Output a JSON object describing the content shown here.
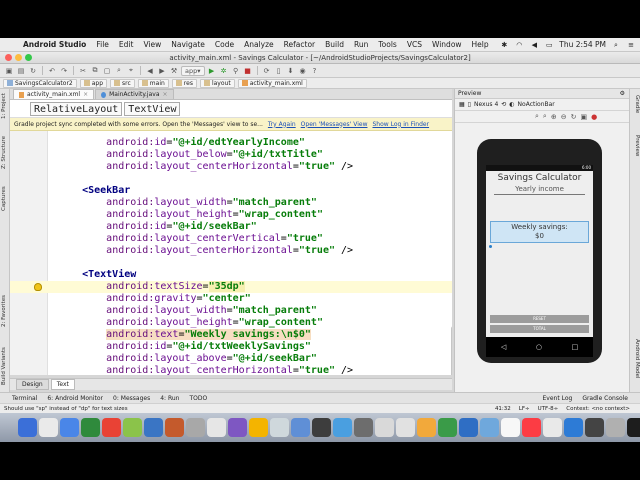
{
  "menubar": {
    "app_name": "Android Studio",
    "items": [
      "File",
      "Edit",
      "View",
      "Navigate",
      "Code",
      "Analyze",
      "Refactor",
      "Build",
      "Run",
      "Tools",
      "VCS",
      "Window",
      "Help"
    ],
    "clock": "Thu 2:54 PM"
  },
  "window": {
    "title": "activity_main.xml - Savings Calculator - [~/AndroidStudioProjects/SavingsCalculator2]"
  },
  "toolbar": {
    "run_config": "app"
  },
  "breadcrumbs": [
    "SavingsCalculator2",
    "app",
    "src",
    "main",
    "res",
    "layout",
    "activity_main.xml"
  ],
  "left_strip": [
    "1: Project",
    "Z: Structure",
    "Captures",
    "2: Favorites",
    "Build Variants"
  ],
  "right_strip": [
    "Gradle",
    "Preview",
    "Android Model"
  ],
  "editor_tabs": [
    {
      "label": "activity_main.xml",
      "active": true
    },
    {
      "label": "MainActivity.java",
      "active": false
    }
  ],
  "tag_path": [
    "RelativeLayout",
    "TextView"
  ],
  "banner": {
    "message": "Gradle project sync completed with some errors. Open the 'Messages' view to se...",
    "links": [
      "Try Again",
      "Open 'Messages' View",
      "Show Log in Finder"
    ]
  },
  "code_lines": [
    {
      "indent": "        ",
      "ns": "android",
      "attr": "id",
      "val": "\"@+id/edtYearlyIncome\"",
      "tail": ""
    },
    {
      "indent": "        ",
      "ns": "android",
      "attr": "layout_below",
      "val": "\"@+id/txtTitle\"",
      "tail": ""
    },
    {
      "indent": "        ",
      "ns": "android",
      "attr": "layout_centerHorizontal",
      "val": "\"true\"",
      "tail": " />"
    },
    {
      "blank": true
    },
    {
      "tagline": "    <SeekBar"
    },
    {
      "indent": "        ",
      "ns": "android",
      "attr": "layout_width",
      "val": "\"match_parent\"",
      "tail": ""
    },
    {
      "indent": "        ",
      "ns": "android",
      "attr": "layout_height",
      "val": "\"wrap_content\"",
      "tail": ""
    },
    {
      "indent": "        ",
      "ns": "android",
      "attr": "id",
      "val": "\"@+id/seekBar\"",
      "tail": ""
    },
    {
      "indent": "        ",
      "ns": "android",
      "attr": "layout_centerVertical",
      "val": "\"true\"",
      "tail": ""
    },
    {
      "indent": "        ",
      "ns": "android",
      "attr": "layout_centerHorizontal",
      "val": "\"true\"",
      "tail": " />"
    },
    {
      "blank": true
    },
    {
      "tagline": "    <TextView"
    },
    {
      "indent": "        ",
      "ns": "android",
      "attr": "textSize",
      "val": "\"35dp\"",
      "tail": "",
      "highlight": true,
      "valbox": "warn"
    },
    {
      "indent": "        ",
      "ns": "android",
      "attr": "gravity",
      "val": "\"center\"",
      "tail": ""
    },
    {
      "indent": "        ",
      "ns": "android",
      "attr": "layout_width",
      "val": "\"match_parent\"",
      "tail": ""
    },
    {
      "indent": "        ",
      "ns": "android",
      "attr": "layout_height",
      "val": "\"wrap_content\"",
      "tail": ""
    },
    {
      "indent": "        ",
      "ns": "android",
      "attr": "text",
      "val": "\"Weekly savings:\\n$0\"",
      "tail": "",
      "linebox": true
    },
    {
      "indent": "        ",
      "ns": "android",
      "attr": "id",
      "val": "\"@+id/txtWeeklySavings\"",
      "tail": ""
    },
    {
      "indent": "        ",
      "ns": "android",
      "attr": "layout_above",
      "val": "\"@+id/seekBar\"",
      "tail": ""
    },
    {
      "indent": "        ",
      "ns": "android",
      "attr": "layout_centerHorizontal",
      "val": "\"true\"",
      "tail": " />"
    }
  ],
  "design_tabs": [
    {
      "label": "Design",
      "active": false
    },
    {
      "label": "Text",
      "active": true
    }
  ],
  "preview": {
    "title": "Preview",
    "device": "Nexus 4",
    "theme": "NoActionBar",
    "app_title": "Savings Calculator",
    "yearly_income": "Yearly income",
    "weekly_savings_line1": "Weekly savings:",
    "weekly_savings_line2": "$0",
    "status_time": "6:00",
    "reset_label": "RESET",
    "total_label": "TOTAL"
  },
  "bottom_tools": {
    "left": [
      "Terminal",
      "6: Android Monitor",
      "0: Messages",
      "4: Run",
      "TODO"
    ],
    "right": [
      "Event Log",
      "Gradle Console"
    ]
  },
  "status_line": {
    "message": "Should use \"sp\" instead of \"dp\" for text sizes",
    "position": "41:32",
    "line_sep": "LF÷",
    "encoding": "UTF-8÷",
    "context": "Context: <no context>"
  },
  "colors": {
    "dock_icons": [
      "#3b6fd8",
      "#eaeaea",
      "#4a86e8",
      "#2f8a3c",
      "#e94235",
      "#8bc34a",
      "#3a75c4",
      "#c45a2c",
      "#a8a8a8",
      "#e6e6e6",
      "#7e57c2",
      "#f4b400",
      "#cfd8dc",
      "#5f8fd6",
      "#3d3d3d",
      "#4a9fe0",
      "#6d6d6d",
      "#d9d9d9",
      "#e1e1e1",
      "#f2a93b",
      "#3a9b48",
      "#2f6ec4",
      "#6fa8dc",
      "#f7f7f7",
      "#fc3c44",
      "#e9e9e9",
      "#2d7bd6",
      "#444444",
      "#b0b0b0",
      "#1d1d1d",
      "#e66b2e",
      "#4a4a4a",
      "#f5c400",
      "#7a7a7a",
      "#c0c0c0",
      "#8aa6c9"
    ]
  }
}
